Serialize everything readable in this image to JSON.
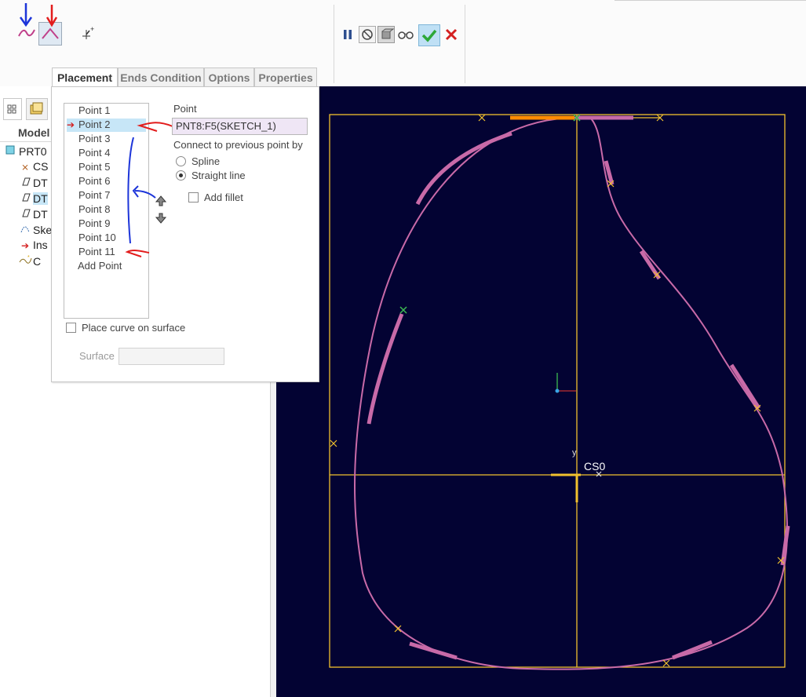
{
  "dashboard": {
    "tabs": [
      {
        "label": "Placement"
      },
      {
        "label": "Ends Condition"
      },
      {
        "label": "Options"
      },
      {
        "label": "Properties"
      }
    ],
    "placement": {
      "points": [
        "Point 1",
        "Point 2",
        "Point 3",
        "Point 4",
        "Point 5",
        "Point 6",
        "Point 7",
        "Point 8",
        "Point 9",
        "Point 10",
        "Point 11"
      ],
      "add_point_label": "Add Point",
      "selected_point": "Point 2",
      "point_heading": "Point",
      "point_value": "PNT8:F5(SKETCH_1)",
      "connect_label": "Connect to previous point by",
      "spline_label": "Spline",
      "straight_label": "Straight line",
      "connection": "Straight line",
      "add_fillet_label": "Add fillet",
      "place_on_surface_label": "Place curve on surface",
      "surface_label": "Surface",
      "surface_value": ""
    }
  },
  "model_tree": {
    "header": "Model",
    "items": [
      {
        "label": "PRT0",
        "icon": "part-icon"
      },
      {
        "label": "CS",
        "icon": "csys-icon"
      },
      {
        "label": "DT",
        "icon": "datum-plane-icon"
      },
      {
        "label": "DT",
        "icon": "datum-plane-icon"
      },
      {
        "label": "DT",
        "icon": "datum-plane-icon"
      },
      {
        "label": "Ske",
        "icon": "sketch-icon"
      },
      {
        "label": "Ins",
        "icon": "insert-here-arrow-icon"
      },
      {
        "label": "C",
        "icon": "curve-icon"
      }
    ]
  },
  "graphics": {
    "csys_label": "CS0",
    "csys_y_label": "y",
    "colors": {
      "background": "#030333",
      "sketch": "#f2c12e",
      "curve": "#c86aa8",
      "highlight": "#ff8c00",
      "point_green": "#3dbb52"
    }
  },
  "colors": {
    "annotation_red": "#e21c1c",
    "annotation_blue": "#1d35d9",
    "accept_green": "#2da838",
    "cancel_red": "#d42020",
    "selection": "#c7e6f7"
  }
}
